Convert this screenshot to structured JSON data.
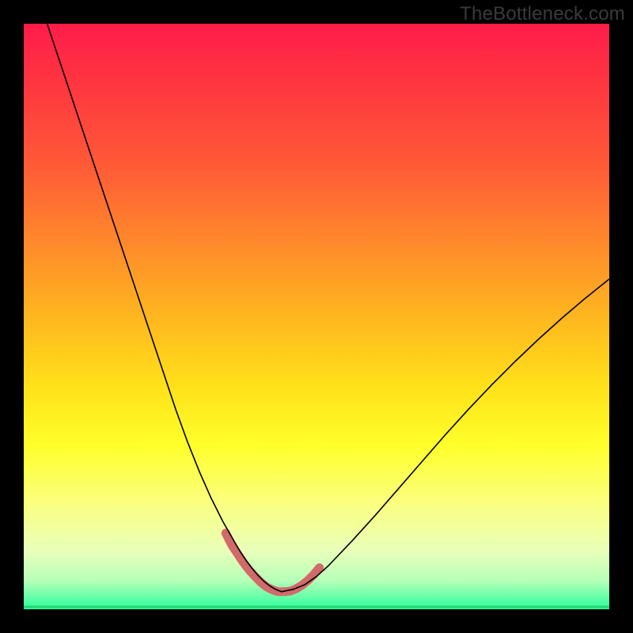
{
  "watermark": "TheBottleneck.com",
  "chart_data": {
    "type": "line",
    "title": "",
    "xlabel": "",
    "ylabel": "",
    "xlim": [
      0,
      100
    ],
    "ylim": [
      0,
      100
    ],
    "axes_visible": false,
    "background": {
      "type": "vertical-gradient",
      "stops": [
        {
          "offset": 0.0,
          "color": "#ff1c49"
        },
        {
          "offset": 0.12,
          "color": "#ff3a3f"
        },
        {
          "offset": 0.25,
          "color": "#ff5d36"
        },
        {
          "offset": 0.38,
          "color": "#ff8b2b"
        },
        {
          "offset": 0.5,
          "color": "#ffb61f"
        },
        {
          "offset": 0.62,
          "color": "#ffe11a"
        },
        {
          "offset": 0.72,
          "color": "#ffff2a"
        },
        {
          "offset": 0.82,
          "color": "#fbff80"
        },
        {
          "offset": 0.9,
          "color": "#e8ffba"
        },
        {
          "offset": 0.95,
          "color": "#b8ffb8"
        },
        {
          "offset": 1.0,
          "color": "#2cff9d"
        }
      ]
    },
    "series": [
      {
        "name": "bottleneck-curve",
        "stroke": "#000000",
        "stroke_width": 1.6,
        "x": [
          4,
          6,
          8,
          10,
          12,
          14,
          16,
          18,
          20,
          22,
          24,
          26,
          28,
          30,
          32,
          34,
          36,
          37,
          38,
          39,
          40,
          41,
          42,
          43,
          44,
          46,
          48,
          50,
          52,
          56,
          60,
          64,
          68,
          72,
          76,
          80,
          84,
          88,
          92,
          96,
          100
        ],
        "y": [
          100,
          94,
          88,
          82,
          76,
          70,
          64,
          58,
          52,
          46,
          40,
          34,
          28.5,
          23.5,
          19,
          15,
          11.5,
          9.8,
          8.3,
          7,
          5.8,
          4.8,
          4,
          3.4,
          3,
          3.4,
          4.2,
          5.6,
          7.4,
          11.6,
          16,
          20.6,
          25.2,
          29.8,
          34.2,
          38.4,
          42.4,
          46.2,
          49.8,
          53.2,
          56.4
        ]
      }
    ],
    "highlight": {
      "name": "valley-highlight",
      "stroke": "#d26a6a",
      "stroke_width": 11,
      "linecap": "round",
      "x": [
        34.5,
        35.5,
        36.5,
        37.5,
        38.5,
        39.5,
        40.5,
        41.5,
        42.5,
        43.5,
        44.5,
        45.5,
        46.5,
        47.5,
        48.5,
        49.5,
        50.5
      ],
      "y": [
        13.0,
        11.0,
        9.5,
        8.0,
        6.7,
        5.6,
        4.6,
        3.8,
        3.3,
        3.0,
        3.0,
        3.1,
        3.5,
        4.1,
        4.9,
        5.9,
        7.1
      ]
    },
    "baseline": {
      "name": "green-baseline",
      "stroke": "#23d673",
      "stroke_width": 3,
      "y": 0.4
    }
  }
}
